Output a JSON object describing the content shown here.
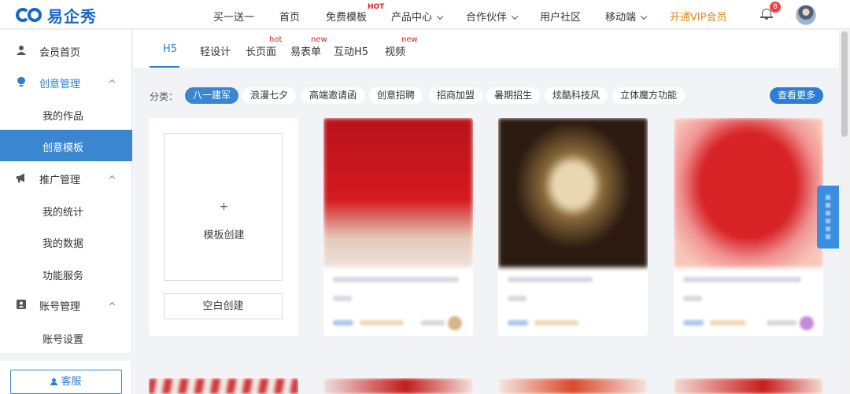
{
  "brand": {
    "name": "易企秀"
  },
  "topnav": {
    "items": [
      {
        "label": "买一送一"
      },
      {
        "label": "首页"
      },
      {
        "label": "免费模板",
        "badge": "HOT"
      },
      {
        "label": "产品中心"
      },
      {
        "label": "合作伙伴"
      },
      {
        "label": "用户社区"
      },
      {
        "label": "移动端"
      },
      {
        "label": "开通VIP会员"
      }
    ],
    "notification_count": "8"
  },
  "sidebar": {
    "home": {
      "label": "会员首页"
    },
    "creative": {
      "label": "创意管理",
      "items": [
        "我的作品",
        "创意模板"
      ]
    },
    "promotion": {
      "label": "推广管理",
      "items": [
        "我的统计",
        "我的数据",
        "功能服务"
      ]
    },
    "account": {
      "label": "账号管理",
      "items": [
        "账号设置"
      ]
    },
    "service_label": "客服"
  },
  "tabs": [
    {
      "label": "H5"
    },
    {
      "label": "轻设计"
    },
    {
      "label": "长页面",
      "badge": "hot"
    },
    {
      "label": "易表单",
      "badge": "new"
    },
    {
      "label": "互动H5"
    },
    {
      "label": "视频",
      "badge": "new"
    }
  ],
  "categories": {
    "label": "分类：",
    "items": [
      "八一建军",
      "浪漫七夕",
      "高端邀请函",
      "创意招聘",
      "招商加盟",
      "暑期招生",
      "炫酷科技风",
      "立体魔方功能"
    ],
    "more_label": "查看更多"
  },
  "create_card": {
    "plus": "+",
    "template_label": "模板创建",
    "blank_label": "空白创建"
  },
  "colors": {
    "accent": "#3a86d1",
    "brand": "#1a67c8",
    "vip": "#e08a16",
    "hot": "#e02020"
  }
}
